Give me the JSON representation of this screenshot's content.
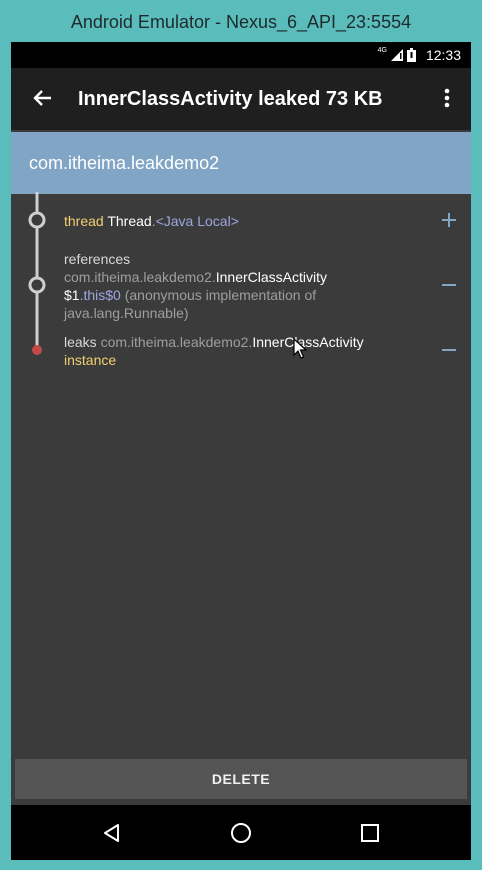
{
  "window": {
    "title": "Android Emulator - Nexus_6_API_23:5554"
  },
  "status_bar": {
    "network": "4G",
    "time": "12:33"
  },
  "toolbar": {
    "title": "InnerClassActivity leaked 73 KB",
    "back_icon": "arrow-back-icon",
    "menu_icon": "more-vert-icon"
  },
  "header": {
    "package": "com.itheima.leakdemo2"
  },
  "trace": {
    "rows": [
      {
        "keyword": "thread",
        "class_name": "Thread",
        "dot": ".",
        "field": "<Java Local>",
        "toggle": "+"
      },
      {
        "keyword": "references",
        "package": "com.itheima.leakdemo2.",
        "class_name": "InnerClassActivity",
        "suffix": "$1",
        "dot": ".",
        "field": "this$0",
        "detail_line1": "(anonymous implementation of",
        "detail_line2": "java.lang.Runnable)",
        "toggle": "−"
      },
      {
        "keyword": "leaks",
        "package": "com.itheima.leakdemo2.",
        "class_name": "InnerClassActivity",
        "suffix": "instance",
        "toggle": "−"
      }
    ]
  },
  "actions": {
    "delete_label": "DELETE"
  },
  "nav_bar": {
    "back_icon": "back-triangle-icon",
    "home_icon": "home-circle-icon",
    "recents_icon": "recents-square-icon"
  },
  "colors": {
    "frame": "#5bbcbc",
    "toolbar": "#1f1f1f",
    "header": "#81a5c5",
    "background": "#3b3b3b",
    "keyword": "#f2cf70",
    "field": "#9ea6e0",
    "toggle": "#81a5c5",
    "leak_dot": "#c24a4a"
  }
}
